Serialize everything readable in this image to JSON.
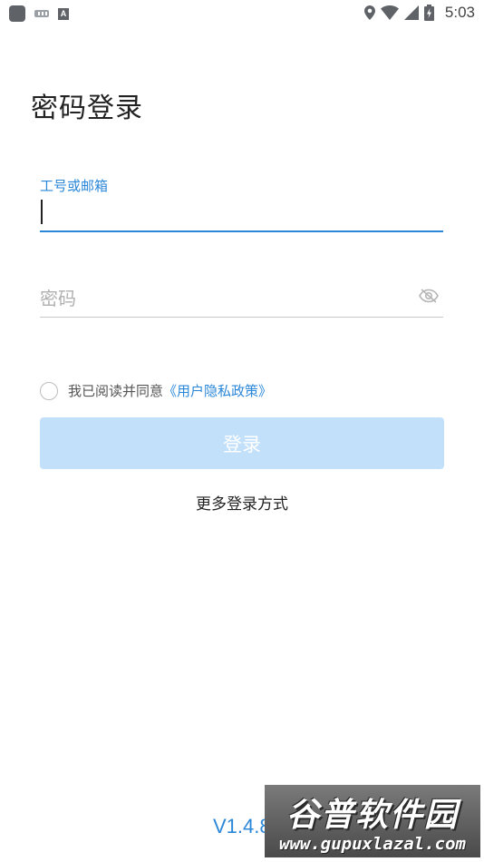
{
  "status_bar": {
    "time": "5:03",
    "left_icons": [
      "app-square-icon",
      "keyboard-icon",
      "font-a-icon"
    ],
    "right_icons": [
      "location-icon",
      "wifi-icon",
      "signal-icon",
      "battery-icon"
    ]
  },
  "page": {
    "title": "密码登录"
  },
  "form": {
    "account_label": "工号或邮箱",
    "account_value": "",
    "password_placeholder": "密码",
    "password_value": "",
    "agree_text": "我已阅读并同意",
    "policy_link": "《用户隐私政策》",
    "login_button": "登录",
    "more_methods": "更多登录方式"
  },
  "footer": {
    "version": "V1.4.8"
  },
  "watermark": {
    "line1": "谷普软件园",
    "line2": "www.gupuxlazal.com"
  },
  "colors": {
    "accent": "#2b87d8",
    "button_disabled": "#c3e0fb"
  }
}
